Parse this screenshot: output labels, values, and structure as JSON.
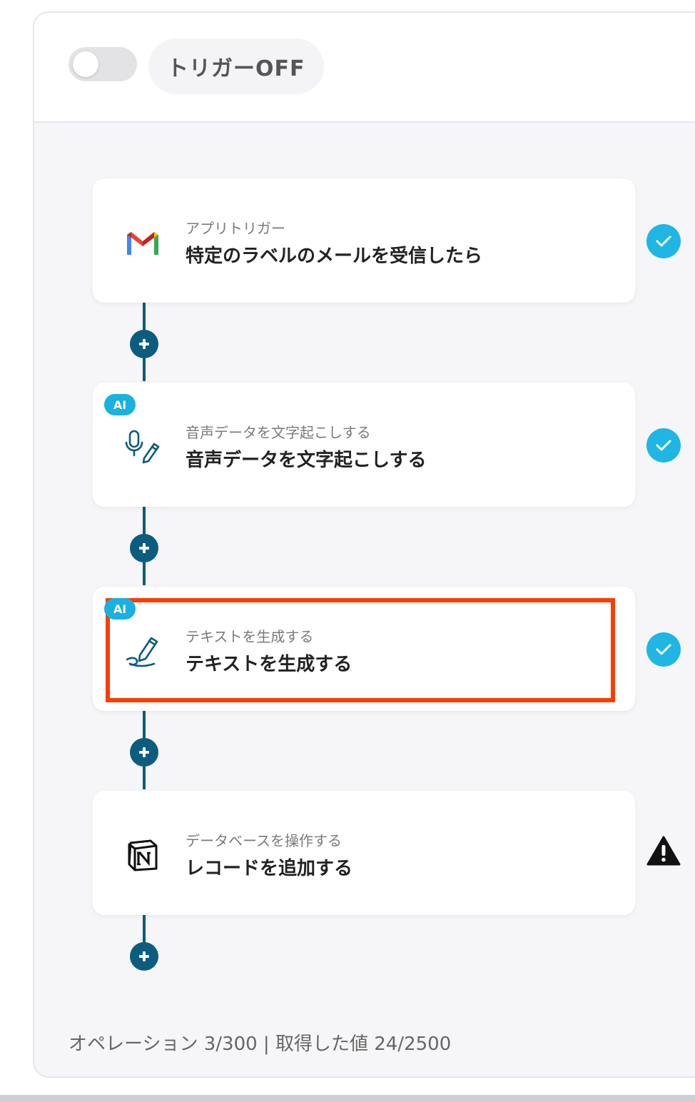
{
  "header": {
    "toggle_state": "off",
    "trigger_label": "トリガーOFF"
  },
  "steps": [
    {
      "subtitle": "アプリトリガー",
      "title": "特定のラベルのメールを受信したら",
      "icon": "gmail-icon",
      "ai": false,
      "status": "complete"
    },
    {
      "subtitle": "音声データを文字起こしする",
      "title": "音声データを文字起こしする",
      "icon": "mic-pen-icon",
      "ai": true,
      "ai_label": "AI",
      "status": "complete"
    },
    {
      "subtitle": "テキストを生成する",
      "title": "テキストを生成する",
      "icon": "pen-wave-icon",
      "ai": true,
      "ai_label": "AI",
      "status": "complete",
      "highlighted": true
    },
    {
      "subtitle": "データベースを操作する",
      "title": "レコードを追加する",
      "icon": "notion-icon",
      "ai": false,
      "status": "warning"
    }
  ],
  "footer": {
    "usage_text": "オペレーション 3/300 | 取得した値 24/2500"
  },
  "colors": {
    "accent": "#1fb6e3",
    "connector": "#0b5c7f",
    "highlight": "#ff3b00",
    "ai_badge": "#1ab0e0"
  }
}
